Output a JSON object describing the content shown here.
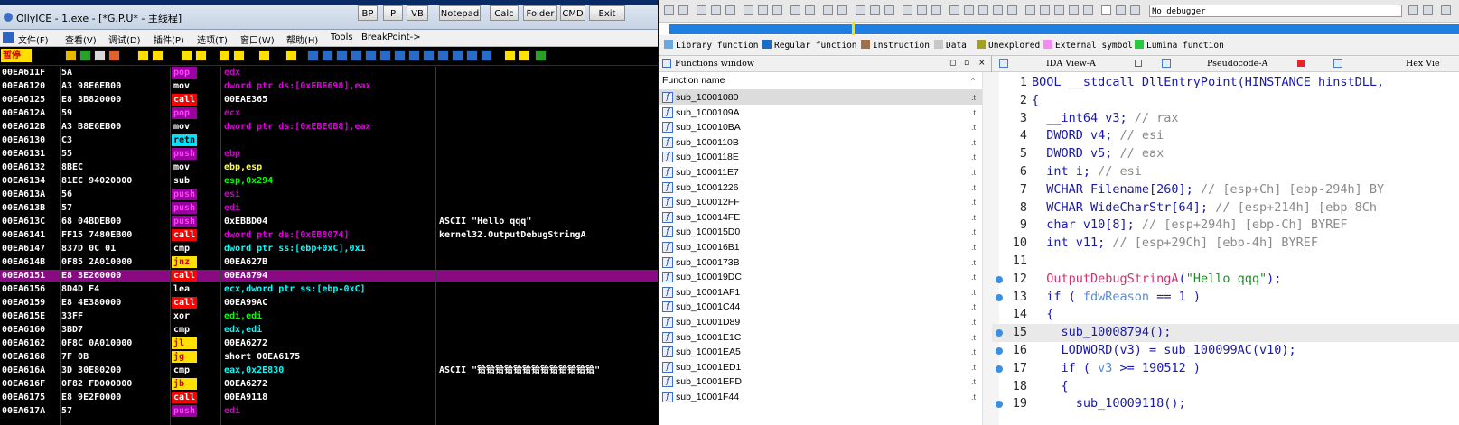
{
  "olly": {
    "title": "OllyICE - 1.exe - [*G.P.U* - 主线程]",
    "tool_buttons": [
      "BP",
      "P",
      "VB",
      "Notepad",
      "Calc",
      "Folder",
      "CMD",
      "Exit"
    ],
    "menu": [
      "文件(F)",
      "查看(V)",
      "调试(D)",
      "插件(P)",
      "选项(T)",
      "窗口(W)",
      "帮助(H)",
      "Tools",
      "BreakPoint->"
    ],
    "status": "暂停",
    "toolbar_letters": [
      "L",
      "E",
      "M",
      "T",
      "W",
      "H",
      "C",
      "/",
      "K",
      "B",
      "R",
      "...",
      "S"
    ],
    "rows": [
      {
        "addr": "00EA611F",
        "hex": "5A",
        "mn": "pop",
        "op": "edx",
        "cm": ""
      },
      {
        "addr": "00EA6120",
        "hex": "A3 98E6EB00",
        "mn": "mov",
        "op": "dword ptr ds:[0xEBE698],eax",
        "cm": ""
      },
      {
        "addr": "00EA6125",
        "hex": "E8 3B820000",
        "mn": "call",
        "op": "00EAE365",
        "cm": ""
      },
      {
        "addr": "00EA612A",
        "hex": "59",
        "mn": "pop",
        "op": "ecx",
        "cm": ""
      },
      {
        "addr": "00EA612B",
        "hex": "A3 B8E6EB00",
        "mn": "mov",
        "op": "dword ptr ds:[0xEBE6B8],eax",
        "cm": ""
      },
      {
        "addr": "00EA6130",
        "hex": "C3",
        "mn": "retn",
        "op": "",
        "cm": ""
      },
      {
        "addr": "00EA6131",
        "hex": "55",
        "mn": "push",
        "op": "ebp",
        "cm": ""
      },
      {
        "addr": "00EA6132",
        "hex": "8BEC",
        "mn": "mov",
        "op": "ebp,esp",
        "cm": ""
      },
      {
        "addr": "00EA6134",
        "hex": "81EC 94020000",
        "mn": "sub",
        "op": "esp,0x294",
        "cm": ""
      },
      {
        "addr": "00EA613A",
        "hex": "56",
        "mn": "push",
        "op": "esi",
        "cm": ""
      },
      {
        "addr": "00EA613B",
        "hex": "57",
        "mn": "push",
        "op": "edi",
        "cm": ""
      },
      {
        "addr": "00EA613C",
        "hex": "68 04BDEB00",
        "mn": "push",
        "op": "0xEBBD04",
        "cm": "ASCII \"Hello qqq\""
      },
      {
        "addr": "00EA6141",
        "hex": "FF15 7480EB00",
        "mn": "call",
        "op": "dword ptr ds:[0xEB8074]",
        "cm": "kernel32.OutputDebugStringA"
      },
      {
        "addr": "00EA6147",
        "hex": "837D 0C 01",
        "mn": "cmp",
        "op": "dword ptr ss:[ebp+0xC],0x1",
        "cm": ""
      },
      {
        "addr": "00EA614B",
        "hex": "0F85 2A010000",
        "mn": "jnz",
        "op": "00EA627B",
        "cm": ""
      },
      {
        "addr": "00EA6151",
        "hex": "E8 3E260000",
        "mn": "call",
        "op": "00EA8794",
        "cm": ""
      },
      {
        "addr": "00EA6156",
        "hex": "8D4D F4",
        "mn": "lea",
        "op": "ecx,dword ptr ss:[ebp-0xC]",
        "cm": ""
      },
      {
        "addr": "00EA6159",
        "hex": "E8 4E380000",
        "mn": "call",
        "op": "00EA99AC",
        "cm": ""
      },
      {
        "addr": "00EA615E",
        "hex": "33FF",
        "mn": "xor",
        "op": "edi,edi",
        "cm": ""
      },
      {
        "addr": "00EA6160",
        "hex": "3BD7",
        "mn": "cmp",
        "op": "edx,edi",
        "cm": ""
      },
      {
        "addr": "00EA6162",
        "hex": "0F8C 0A010000",
        "mn": "jl",
        "op": "00EA6272",
        "cm": ""
      },
      {
        "addr": "00EA6168",
        "hex": "7F 0B",
        "mn": "jg",
        "op": "short 00EA6175",
        "cm": ""
      },
      {
        "addr": "00EA616A",
        "hex": "3D 30E80200",
        "mn": "cmp",
        "op": "eax,0x2E830",
        "cm": "ASCII \"铪铪铪铪铪铪铪铪铪铪铪铪铪\""
      },
      {
        "addr": "00EA616F",
        "hex": "0F82 FD000000",
        "mn": "jb",
        "op": "00EA6272",
        "cm": ""
      },
      {
        "addr": "00EA6175",
        "hex": "E8 9E2F0000",
        "mn": "call",
        "op": "00EA9118",
        "cm": ""
      },
      {
        "addr": "00EA617A",
        "hex": "57",
        "mn": "push",
        "op": "edi",
        "cm": ""
      }
    ],
    "selected_row": 15,
    "colors": {
      "pop": "#9a00a0",
      "push": "#9a00a0",
      "mov": "#000000",
      "sub": "#000000",
      "retn": "#00e4ff",
      "call": "#ff0000",
      "cmp": "#000000",
      "lea": "#000000",
      "xor": "#000000",
      "jnz": "#ffe000",
      "jl": "#ffe000",
      "jg": "#ffe000",
      "jb": "#ffe000"
    }
  },
  "ida": {
    "debugger_select": "No debugger",
    "legend": [
      {
        "label": "Library function",
        "color": "#6aa8e0"
      },
      {
        "label": "Regular function",
        "color": "#1b6cc7"
      },
      {
        "label": "Instruction",
        "color": "#a0704a"
      },
      {
        "label": "Data",
        "color": "#c8c8c8"
      },
      {
        "label": "Unexplored",
        "color": "#a0a02a"
      },
      {
        "label": "External symbol",
        "color": "#f48cf0"
      },
      {
        "label": "Lumina function",
        "color": "#28c840"
      }
    ],
    "functions_window_title": "Functions window",
    "functions_header": "Function name",
    "functions": [
      "sub_10001080",
      "sub_1000109A",
      "sub_100010BA",
      "sub_1000110B",
      "sub_1000118E",
      "sub_100011E7",
      "sub_10001226",
      "sub_100012FF",
      "sub_100014FE",
      "sub_100015D0",
      "sub_100016B1",
      "sub_1000173B",
      "sub_100019DC",
      "sub_10001AF1",
      "sub_10001C44",
      "sub_10001D89",
      "sub_10001E1C",
      "sub_10001EA5",
      "sub_10001ED1",
      "sub_10001EFD",
      "sub_10001F44"
    ],
    "selected_function": 0,
    "tabs": [
      {
        "label": "IDA View-A"
      },
      {
        "label": "Pseudocode-A"
      },
      {
        "label": "Hex Vie"
      }
    ],
    "pseudocode": [
      {
        "n": "1",
        "html": "BOOL __stdcall DllEntryPoint(HINSTANCE hinstDLL,",
        "bp": false
      },
      {
        "n": "2",
        "html": "{",
        "bp": false
      },
      {
        "n": "3",
        "html": "  __int64 v3; // rax",
        "bp": false
      },
      {
        "n": "4",
        "html": "  DWORD v4; // esi",
        "bp": false
      },
      {
        "n": "5",
        "html": "  DWORD v5; // eax",
        "bp": false
      },
      {
        "n": "6",
        "html": "  int i; // esi",
        "bp": false
      },
      {
        "n": "7",
        "html": "  WCHAR Filename[260]; // [esp+Ch] [ebp-294h] BY",
        "bp": false
      },
      {
        "n": "8",
        "html": "  WCHAR WideCharStr[64]; // [esp+214h] [ebp-8Ch",
        "bp": false
      },
      {
        "n": "9",
        "html": "  char v10[8]; // [esp+294h] [ebp-Ch] BYREF",
        "bp": false
      },
      {
        "n": "10",
        "html": "  int v11; // [esp+29Ch] [ebp-4h] BYREF",
        "bp": false
      },
      {
        "n": "11",
        "html": "",
        "bp": false
      },
      {
        "n": "12",
        "html": "  OutputDebugStringA(\"Hello qqq\");",
        "bp": true
      },
      {
        "n": "13",
        "html": "  if ( fdwReason == 1 )",
        "bp": true
      },
      {
        "n": "14",
        "html": "  {",
        "bp": false
      },
      {
        "n": "15",
        "html": "    sub_10008794();",
        "bp": true
      },
      {
        "n": "16",
        "html": "    LODWORD(v3) = sub_100099AC(v10);",
        "bp": true
      },
      {
        "n": "17",
        "html": "    if ( v3 >= 190512 )",
        "bp": true
      },
      {
        "n": "18",
        "html": "    {",
        "bp": false
      },
      {
        "n": "19",
        "html": "      sub_10009118();",
        "bp": true
      }
    ],
    "highlight_line": 14
  }
}
